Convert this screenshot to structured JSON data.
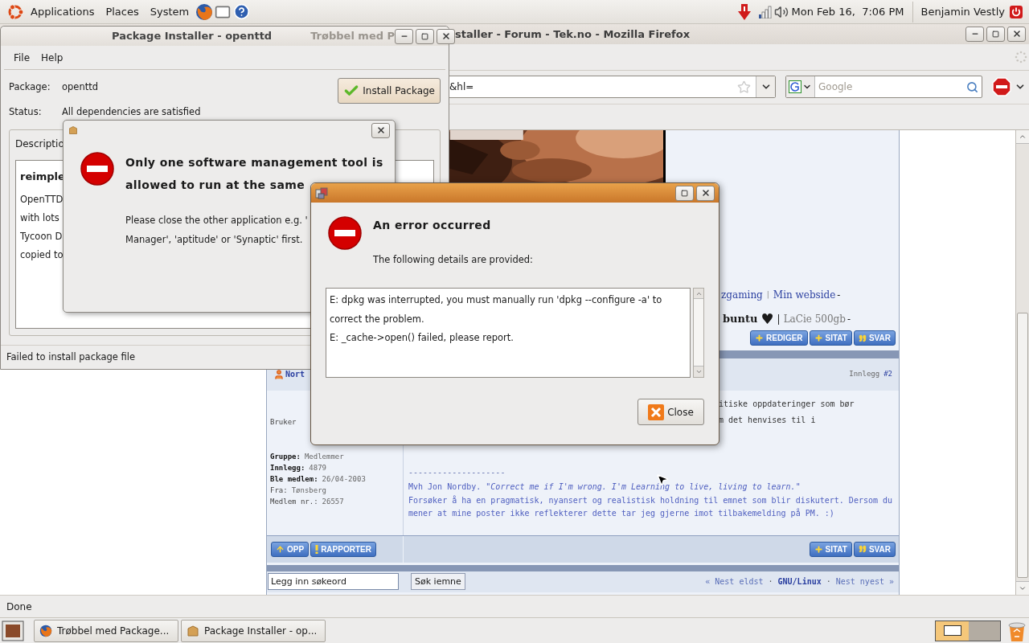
{
  "top_panel": {
    "menus": [
      "Applications",
      "Places",
      "System"
    ],
    "clock": "Mon Feb 16,  7:06 PM",
    "user": "Benjamin Vestly"
  },
  "firefox": {
    "title_ghost": "Trøbbel med P",
    "title": "staller - Forum - Tek.no - Mozilla Firefox",
    "url": "&hl=",
    "search_placeholder": "Google",
    "status": "Done",
    "forum": {
      "sig_links": [
        "zgaming",
        "Min webside"
      ],
      "sig_dash": "-",
      "sig2": {
        "os": "buntu",
        "heart": "♥",
        "sep": "|",
        "disk": "LaCie 500gb",
        "dash": "-"
      },
      "post1_buttons": [
        {
          "label": "REDIGER",
          "kind": "plus"
        },
        {
          "label": "SITAT",
          "kind": "plus"
        },
        {
          "label": "SVAR",
          "kind": "quote"
        }
      ],
      "author": "Nort",
      "post_label": "Innlegg",
      "post_number": "#2",
      "rank": "Bruker",
      "profile": [
        {
          "label": "Gruppe:",
          "value": "Medlemmer",
          "bold": true
        },
        {
          "label": "Innlegg:",
          "value": "4879",
          "bold": true
        },
        {
          "label": "Ble medlem:",
          "value": "26/04-2003",
          "bold": true
        },
        {
          "label": "Fra:",
          "value": "Tønsberg",
          "bold": false
        },
        {
          "label": "Medlem nr.:",
          "value": "26557",
          "bold": false
        }
      ],
      "body_lines": [
        "itiske oppdateringer som bør",
        "m det henvises til i"
      ],
      "sig_rule": "--------------------",
      "sig_quote": "Mvh Jon Nordby. *\"Correct me if I'm wrong. I'm Learning to live, living to learn.\"*",
      "sig_text": "Forsøker å ha en pragmatisk, nyansert og realistisk holdning til emnet som blir diskutert. Dersom du mener at mine poster ikke reflekterer dette tar jeg gjerne imot tilbakemelding på PM. :)",
      "footer_left": [
        {
          "label": "OPP",
          "kind": "up"
        },
        {
          "label": "RAPPORTER",
          "kind": "alert"
        }
      ],
      "footer_right": [
        {
          "label": "SITAT",
          "kind": "plus"
        },
        {
          "label": "SVAR",
          "kind": "quote"
        }
      ],
      "search_value": "Legg inn søkeord",
      "search_button": "Søk iemne",
      "nav": [
        {
          "text": "« Nest eldst",
          "kind": "link"
        },
        {
          "text": "·",
          "kind": "sep"
        },
        {
          "text": "GNU/Linux",
          "kind": "current"
        },
        {
          "text": "·",
          "kind": "sep"
        },
        {
          "text": "Nest nyest »",
          "kind": "link"
        }
      ]
    }
  },
  "package_installer": {
    "title": "Package Installer - openttd",
    "menus": [
      "File",
      "Help"
    ],
    "package_label": "Package:",
    "package": "openttd",
    "status_label": "Status:",
    "status": "All dependencies are satisfied",
    "install_button": "Install Package",
    "tab": "Descriptio",
    "desc_title": "reimple",
    "desc_lines": [
      "OpenTTD",
      "with lots",
      "Tycoon D",
      "copied to"
    ],
    "statusbar": "Failed to install package file"
  },
  "lock_dialog": {
    "heading_lines": [
      "Only one software management tool is",
      "allowed to run at the same"
    ],
    "body_lines": [
      "Please close the other application e.g. '",
      "Manager', 'aptitude' or 'Synaptic' first."
    ]
  },
  "error_dialog": {
    "heading": "An error occurred",
    "subheading": "The following details are provided:",
    "details": [
      "E: dpkg was interrupted, you must manually run 'dpkg --configure -a' to correct the problem.",
      "E: _cache->open() failed, please report."
    ],
    "close_button": "Close"
  },
  "taskbar": {
    "tasks": [
      "Trøbbel med Package...",
      "Package Installer - op..."
    ]
  }
}
